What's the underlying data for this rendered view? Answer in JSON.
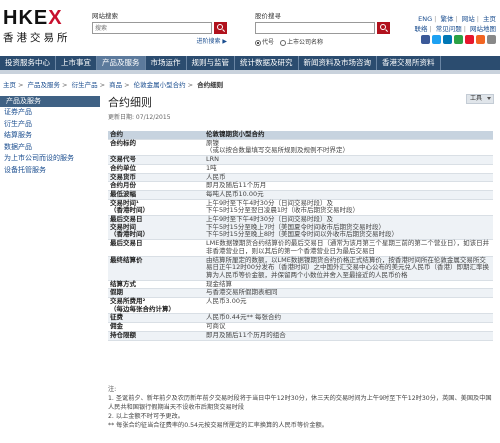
{
  "header": {
    "logo_en": "HKEX",
    "logo_zh": "香港交易所",
    "site_search": {
      "label": "网站搜索",
      "placeholder": "搜索"
    },
    "advanced_search": "进阶搜索 ▶",
    "stock_search": {
      "label": "股价搜寻",
      "placeholder": ""
    },
    "radio_code": "代号",
    "radio_name": "上市公司名称",
    "top_links": [
      "ENG",
      "繁体",
      "网站",
      "主页"
    ],
    "top_links2": [
      "联络",
      "常见问题",
      "网站地图"
    ]
  },
  "nav": {
    "items": [
      "投资服务中心",
      "上市事宜",
      "产品及服务",
      "市场运作",
      "规则与监管",
      "统计数据及研究",
      "新闻资料及市场咨询",
      "香港交易所资料"
    ]
  },
  "breadcrumb": [
    "主页",
    "产品及服务",
    "衍生产品",
    "商品",
    "伦敦金属小型合约",
    "合约细则"
  ],
  "sidebar": {
    "title": "产品及服务",
    "items": [
      "证券产品",
      "衍生产品",
      "结算服务",
      "数据产品",
      "为上市公司而设的服务",
      "设备托管服务"
    ]
  },
  "main": {
    "title": "合约细则",
    "updated": "更新日期: 07/12/2015",
    "tools_label": "工具"
  },
  "spec_table": [
    {
      "k": "合约",
      "v": "伦敦镍期货小型合约"
    },
    {
      "k": "合约标的",
      "v": "原镍\n（或以按合数量填写交易所规则及规例不时界定）"
    },
    {
      "k": "交易代号",
      "v": "LRN"
    },
    {
      "k": "合约单位",
      "v": "1吨"
    },
    {
      "k": "交易货币",
      "v": "人民币"
    },
    {
      "k": "合约月份",
      "v": "即月及随后11个历月"
    },
    {
      "k": "最低波幅",
      "v": "每吨人民币10.00元"
    },
    {
      "k": "交易时间¹\n（香港时间）",
      "v": "上午9时至下午4时30分（日间交易时段）及\n下午5时15分至翌日凌晨1时（收市后期货交易时段）"
    },
    {
      "k": "最后交易日\n交易时间\n（香港时间）",
      "v": "上午9时至下午4时30分（日间交易时段）及\n下午5时15分至晚上7时（美国夏令时间收市后期货交易时段）\n下午5时15分至晚上8时（美国夏令时间以外收市后期货交易时段）"
    },
    {
      "k": "最后交易日",
      "v": "LME数据镍期货合约结算价的最后交易日（通常为该月第三个星期三前的第二个营业日），如该日并非香港营业日，则以其后的第一个香港营业日为最后交易日"
    },
    {
      "k": "最终结算价",
      "v": "由结算所厘定的数额，以LME数据镍期货合约价格正式结算价，按香港时间所在伦敦金属交易所交易日正午12时00分发布（香港时间）之中国外汇交易中心公布的美元兑人民币（香港）即期汇率换算为人民币等价金额，并保留两个小数位并舍入至最接近的人民币价格"
    },
    {
      "k": "结算方式",
      "v": "现金结算"
    },
    {
      "k": "假期",
      "v": "与香港交易所假期表相同"
    },
    {
      "k": "交易所费用²\n（每边每张合约计算）",
      "v": "人民币3.00元"
    },
    {
      "k": "征费",
      "v": "人民币0.44元** 每张合约"
    },
    {
      "k": "佣金",
      "v": "可商议"
    },
    {
      "k": "持仓限额",
      "v": "即月及随后11个历月的组合"
    }
  ],
  "notes": [
    "注:",
    "1. 圣诞前夕、新年前夕及农历新年前夕交易时段将于当日中午12时30分，休三天的交易时间为上午9时至下午12时30分，英国、美国及中国人民共和国银行假期当天不设收市后期货交易时段",
    "2. 以上金额不时可予更改。",
    "** 每张合约征当合征费率的0.54元按交易所厘定的汇率换算的人民币等价金额。"
  ],
  "colors": {
    "brand_red": "#c8102e",
    "nav_bg": "#2b4c6f",
    "link": "#1a4d8f"
  }
}
